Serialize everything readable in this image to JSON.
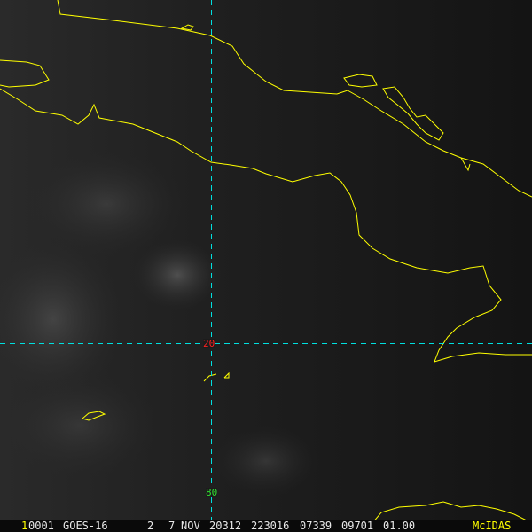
{
  "grid": {
    "lat_label": "20",
    "lon_label": "80",
    "lat_color": "#ff2020",
    "lon_color": "#30e030",
    "line_color": "#00e0e0"
  },
  "coast_color": "#ffff00",
  "status_bar": {
    "frame": "1",
    "id": "0001",
    "satellite": "GOES-16",
    "band": "2",
    "day": "7",
    "month": "NOV",
    "julian": "20312",
    "time": "223016",
    "line": "07339",
    "element": "09701",
    "res": "01.00",
    "software": "McIDAS"
  }
}
